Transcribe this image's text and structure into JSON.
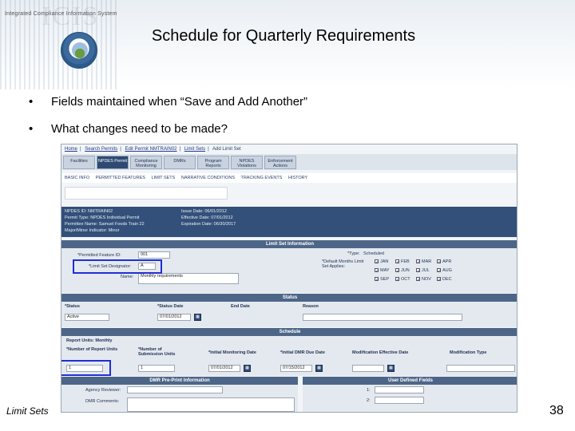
{
  "header": {
    "system_name": "Integrated Compliance Information System",
    "logo_text": "ICIS",
    "title": "Schedule for Quarterly Requirements"
  },
  "bullets": [
    "Fields maintained when “Save and Add Another”",
    "What changes need to be made?"
  ],
  "app": {
    "breadcrumb": [
      "Home",
      "Search Permits",
      "Edit Permit NMTRAIN02",
      "Limit Sets",
      "Add Limit Set"
    ],
    "tabs": [
      "Facilities",
      "NPDES Permit",
      "Compliance Monitoring",
      "DMRs",
      "Program Reports",
      "NPDES Violations",
      "Enforcement Actions"
    ],
    "active_tab": "NPDES Permit",
    "subnav": [
      "BASIC INFO",
      "PERMITTED FEATURES",
      "LIMIT SETS",
      "NARRATIVE CONDITIONS",
      "TRACKING EVENTS",
      "HISTORY"
    ],
    "permit_info": {
      "npdes_id": "NPDES ID: NMTRAIN02",
      "permit_type": "Permit Type: NPDES Individual Permit",
      "permittee": "Permittee Name: Samuel Foods Train 22",
      "major_minor": "Major/Minor Indicator: Minor",
      "issue_date": "Issue Date: 06/01/2012",
      "effective_date": "Effective Date: 07/01/2012",
      "expiration_date": "Expiration Date: 06/30/2017"
    },
    "limit_set_info": {
      "section_title": "Limit Set Information",
      "permitted_feature_label": "*Permitted Feature ID:",
      "permitted_feature_value": "001",
      "designator_label": "*Limit Set Designator:",
      "designator_value": "A",
      "name_label": "Name:",
      "name_value": "Monthly requirements",
      "type_label": "*Type:",
      "type_value": "Scheduled",
      "months_label": "*Default Months Limit Set Applies:",
      "months": [
        "JAN",
        "FEB",
        "MAR",
        "APR",
        "MAY",
        "JUN",
        "JUL",
        "AUG",
        "SEP",
        "OCT",
        "NOV",
        "DEC"
      ]
    },
    "status": {
      "section_title": "Status",
      "headers": [
        "*Status",
        "*Status Date",
        "End Date",
        "Reason"
      ],
      "status_value": "Active",
      "status_date_value": "07/01/2012"
    },
    "schedule": {
      "section_title": "Schedule",
      "report_units_label": "Report Units: Monthly",
      "headers": [
        "*Number of Report Units",
        "*Number of Submission Units",
        "*Initial Monitoring Date",
        "*Initial DMR Due Date",
        "Modification Effective Date",
        "Modification Type"
      ],
      "report_units_value": "1",
      "submission_units_value": "1",
      "initial_monitoring_date": "07/01/2012",
      "initial_dmr_due_date": "07/15/2012"
    },
    "dmr_preprint": {
      "section_title": "DMR Pre-Print Information",
      "agency_reviewer_label": "Agency Reviewer:",
      "dmr_comments_label": "DMR Comments:"
    },
    "user_defined": {
      "section_title": "User Defined Fields",
      "rows": [
        "1:",
        "2:"
      ]
    }
  },
  "footer": {
    "left_label": "Limit Sets",
    "page_number": "38"
  },
  "colors": {
    "highlight": "#1f2fd6",
    "nav_dark": "#2e4a73",
    "section_bar": "#4d6688"
  }
}
